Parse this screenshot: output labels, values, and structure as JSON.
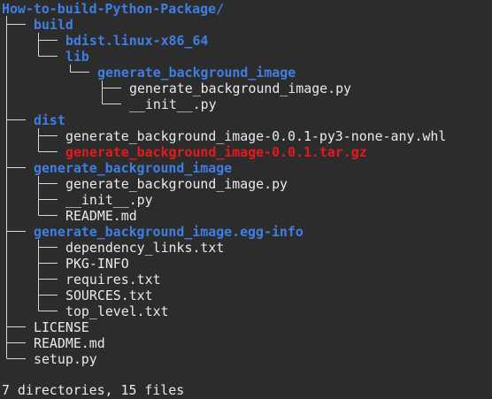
{
  "terminal": {
    "root": "How-to-build-Python-Package/",
    "entries": {
      "build": "build",
      "bdist": "bdist.linux-x86_64",
      "lib": "lib",
      "lib_pkg": "generate_background_image",
      "lib_pkg_main": "generate_background_image.py",
      "lib_pkg_init": "__init__.py",
      "dist": "dist",
      "dist_whl": "generate_background_image-0.0.1-py3-none-any.whl",
      "dist_tar": "generate_background_image-0.0.1.tar.gz",
      "pkg": "generate_background_image",
      "pkg_main": "generate_background_image.py",
      "pkg_init": "__init__.py",
      "pkg_readme": "README.md",
      "egg": "generate_background_image.egg-info",
      "egg_dep": "dependency_links.txt",
      "egg_pkginfo": "PKG-INFO",
      "egg_req": "requires.txt",
      "egg_sources": "SOURCES.txt",
      "egg_top": "top_level.txt",
      "license": "LICENSE",
      "readme": "README.md",
      "setup": "setup.py"
    },
    "summary": "7 directories, 15 files"
  },
  "colors": {
    "background": "#2c2c2c",
    "directory": "#3f7fe4",
    "file": "#eaeaea",
    "archive": "#e6191c",
    "tree_lines": "#d8d8d8"
  }
}
